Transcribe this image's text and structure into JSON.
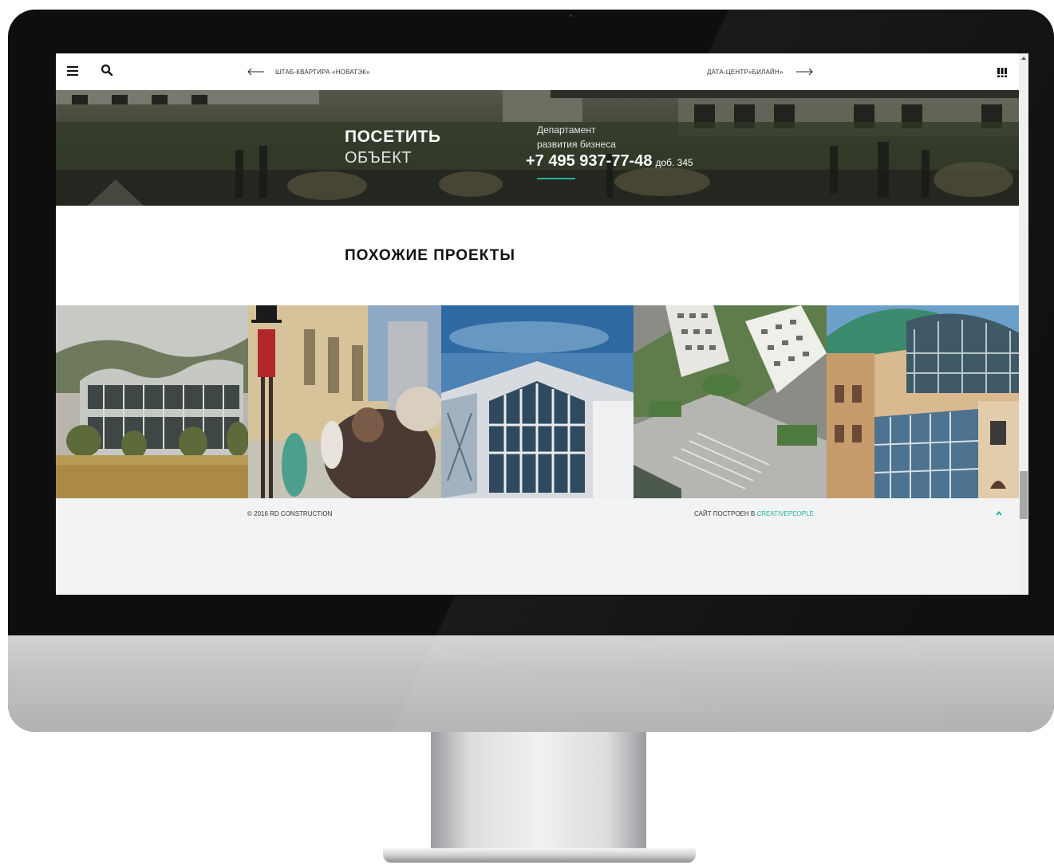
{
  "header": {
    "prev_project": "ШТАБ-КВАРТИРА «НОВАТЭК»",
    "next_project": "ДАТА-ЦЕНТР«БИЛАЙН»"
  },
  "visit": {
    "title_line_1": "ПОСЕТИТЬ",
    "title_line_2": "ОБЪЕКТ",
    "department_line_1": "Департамент",
    "department_line_2": "развития бизнеса",
    "phone": "+7 495 937-77-48",
    "extension": "доб. 345"
  },
  "similar": {
    "title": "ПОХОЖИЕ ПРОЕКТЫ"
  },
  "footer": {
    "copyright": "© 2016 RD CONSTRUCTION",
    "credit_prefix": "САЙТ ПОСТРОЕН В ",
    "credit_link": "CREATIVEPEOPLE"
  },
  "colors": {
    "accent": "#27b39b",
    "footer_bg": "#f2f3f4",
    "bezel": "#0e0e0f"
  },
  "icons": [
    "menu-icon",
    "search-icon",
    "arrow-left-icon",
    "arrow-right-icon",
    "grid-icon",
    "chevron-up-icon"
  ]
}
